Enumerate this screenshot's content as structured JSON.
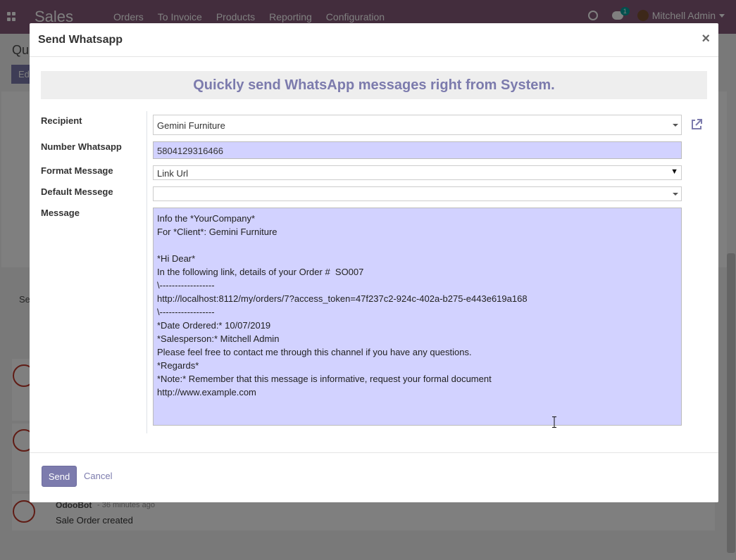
{
  "navbar": {
    "brand": "Sales",
    "menu": [
      "Orders",
      "To Invoice",
      "Products",
      "Reporting",
      "Configuration"
    ],
    "chat_badge": "1",
    "user_name": "Mitchell Admin"
  },
  "background": {
    "breadcrumb": "Qu",
    "edit_label": "Ed",
    "partial_text": "Se",
    "bot_name": "OdooBot",
    "bot_time": "- 36 minutes ago",
    "bot_message": "Sale Order created"
  },
  "modal": {
    "title": "Send Whatsapp",
    "close_label": "×",
    "banner": "Quickly send WhatsApp messages right from System.",
    "labels": {
      "recipient": "Recipient",
      "number": "Number Whatsapp",
      "format": "Format Message",
      "default": "Default Messege",
      "message": "Message"
    },
    "recipient_value": "Gemini Furniture",
    "number_value": "5804129316466",
    "format_value": "Link Url",
    "default_value": "",
    "message_lines": [
      "Info the *YourCompany*",
      "For *Client*: Gemini Furniture",
      "",
      "*Hi Dear*",
      "In the following link, details of your Order #  SO007",
      "\\------------------",
      "http://localhost:8112/my/orders/7?access_token=47f237c2-924c-402a-b275-e443e619a168",
      "\\------------------",
      "*Date Ordered:* 10/07/2019",
      "*Salesperson:* Mitchell Admin",
      "Please feel free to contact me through this channel if you have any questions.",
      "*Regards*",
      "*Note:* Remember that this message is informative, request your formal document",
      "http://www.example.com"
    ],
    "send_label": "Send",
    "cancel_label": "Cancel"
  },
  "colors": {
    "navbar": "#875a7b",
    "primary": "#7c7bad",
    "highlight_field": "#d2d2ff"
  }
}
